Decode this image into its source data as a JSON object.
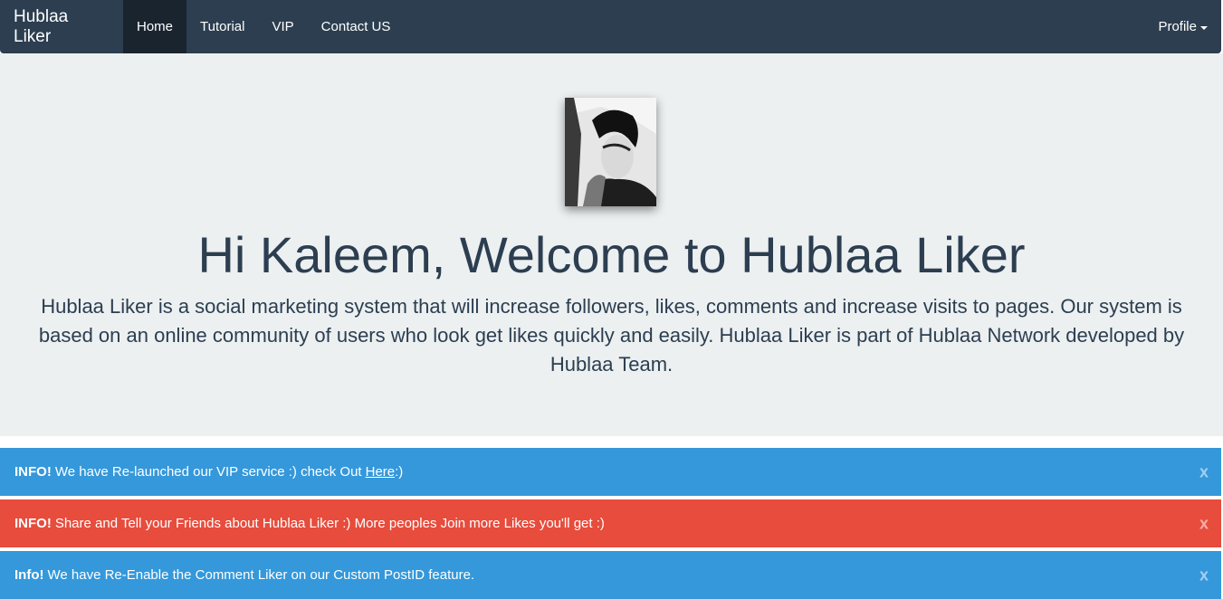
{
  "navbar": {
    "brand": "Hublaa Liker",
    "items": [
      {
        "label": "Home",
        "active": true
      },
      {
        "label": "Tutorial",
        "active": false
      },
      {
        "label": "VIP",
        "active": false
      },
      {
        "label": "Contact US",
        "active": false
      }
    ],
    "profile_label": "Profile"
  },
  "hero": {
    "title": "Hi Kaleem, Welcome to Hublaa Liker",
    "description": "Hublaa Liker is a social marketing system that will increase followers, likes, comments and increase visits to pages. Our system is based on an online community of users who look get likes quickly and easily. Hublaa Liker is part of Hublaa Network developed by Hublaa Team."
  },
  "alerts": [
    {
      "prefix": "INFO!",
      "text": "We have Re-launched our VIP service :) check Out",
      "link": "Here",
      "suffix": " :)",
      "close": "x",
      "style": "info",
      "color": "#3498db"
    },
    {
      "prefix": "INFO!",
      "text": "Share and Tell your Friends about Hublaa Liker :) More peoples Join more Likes you'll get :)",
      "close": "x",
      "style": "danger",
      "color": "#e74c3c"
    },
    {
      "prefix": "Info!",
      "text": "We have Re-Enable the Comment Liker on our Custom PostID feature.",
      "close": "x",
      "style": "info",
      "color": "#3498db"
    }
  ],
  "colors": {
    "navbar_bg": "#2c3e50",
    "jumbotron_bg": "#ecf0f1",
    "info": "#3498db",
    "danger": "#e74c3c"
  }
}
